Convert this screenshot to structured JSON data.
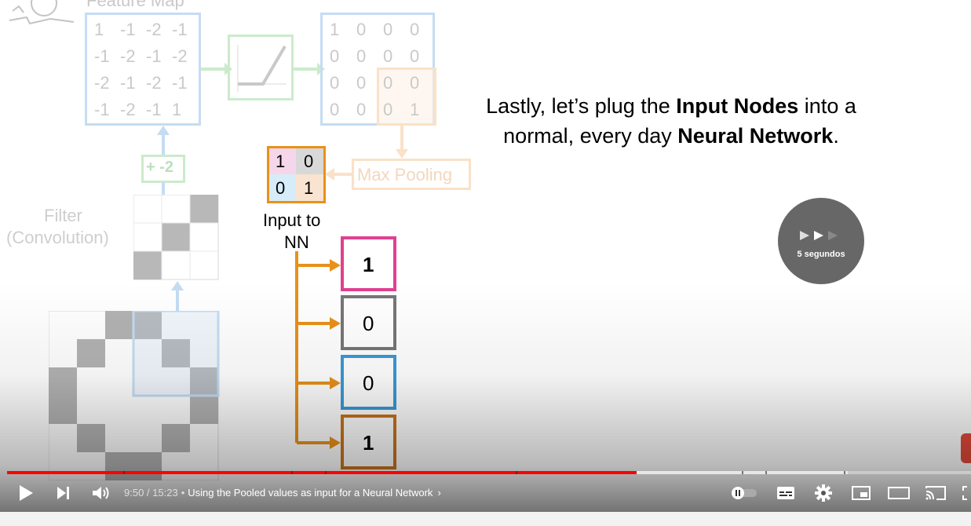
{
  "slide": {
    "feature_map_title": "Feature Map",
    "feature_map": [
      [
        "1",
        "-1",
        "-2",
        "-1"
      ],
      [
        "-1",
        "-2",
        "-1",
        "-2"
      ],
      [
        "-2",
        "-1",
        "-2",
        "-1"
      ],
      [
        "-1",
        "-2",
        "-1",
        "1"
      ]
    ],
    "relu_output": [
      [
        "1",
        "0",
        "0",
        "0"
      ],
      [
        "0",
        "0",
        "0",
        "0"
      ],
      [
        "0",
        "0",
        "0",
        "0"
      ],
      [
        "0",
        "0",
        "0",
        "1"
      ]
    ],
    "bias_label": "+ -2",
    "filter_label_line1": "Filter",
    "filter_label_line2": "(Convolution)",
    "max_pooling_label": "Max Pooling",
    "pooled": [
      [
        "1",
        "0"
      ],
      [
        "0",
        "1"
      ]
    ],
    "input_label_line1": "Input to",
    "input_label_line2": "NN",
    "input_nodes": [
      "1",
      "0",
      "0",
      "1"
    ],
    "caption_part1": "Lastly, let’s plug the ",
    "caption_bold1": "Input Nodes",
    "caption_part2": " into a normal, every day ",
    "caption_bold2": "Neural Network",
    "caption_part3": "."
  },
  "skip_overlay": {
    "label": "5 segundos"
  },
  "player": {
    "current_time": "9:50",
    "duration": "15:23",
    "chapter_separator": "•",
    "chapter_title": "Using the Pooled values as input for a Neural Network",
    "played_fraction": 0.653,
    "buffered_fraction": 0.872
  },
  "colors": {
    "progress_red": "#ff0000",
    "node_pink": "#e0418f",
    "node_gray": "#777777",
    "node_blue": "#3a9ad9",
    "node_orange": "#c8741a",
    "connector_orange": "#e8911a"
  }
}
